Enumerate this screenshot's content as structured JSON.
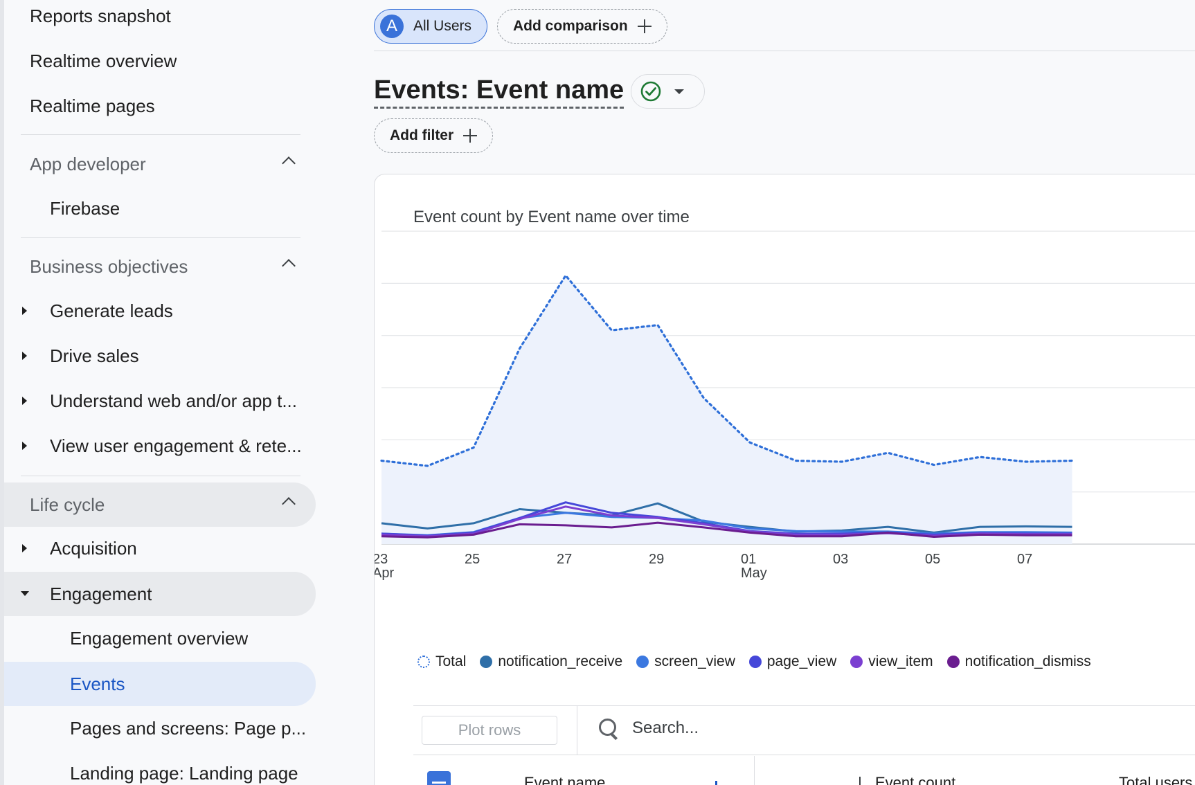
{
  "sidebar": {
    "items_top": [
      {
        "label": "Reports snapshot"
      },
      {
        "label": "Realtime overview"
      },
      {
        "label": "Realtime pages"
      }
    ],
    "app_developer": {
      "label": "App developer",
      "items": [
        {
          "label": "Firebase"
        }
      ]
    },
    "business_objectives": {
      "label": "Business objectives",
      "items": [
        {
          "label": "Generate leads"
        },
        {
          "label": "Drive sales"
        },
        {
          "label": "Understand web and/or app t..."
        },
        {
          "label": "View user engagement & rete..."
        }
      ]
    },
    "life_cycle": {
      "label": "Life cycle",
      "acquisition": {
        "label": "Acquisition"
      },
      "engagement": {
        "label": "Engagement",
        "items": [
          {
            "label": "Engagement overview"
          },
          {
            "label": "Events",
            "selected": true
          },
          {
            "label": "Pages and screens: Page p..."
          },
          {
            "label": "Landing page: Landing page"
          }
        ]
      }
    }
  },
  "header": {
    "segment_avatar": "A",
    "segment_label": "All Users",
    "add_comparison": "Add comparison",
    "title": "Events: Event name",
    "add_filter": "Add filter"
  },
  "chart_card": {
    "title": "Event count by Event name over time",
    "legend": [
      {
        "name": "Total",
        "color": "#2e6fd8"
      },
      {
        "name": "notification_receive",
        "color": "#2f6fa8"
      },
      {
        "name": "screen_view",
        "color": "#3b78e0"
      },
      {
        "name": "page_view",
        "color": "#4547d9"
      },
      {
        "name": "view_item",
        "color": "#7b3fd1"
      },
      {
        "name": "notification_dismiss",
        "color": "#6a1d8f"
      }
    ]
  },
  "chart_data": {
    "type": "line",
    "x_tick_labels": [
      "23",
      "25",
      "27",
      "29",
      "01",
      "03",
      "05",
      "07"
    ],
    "x_tick_sublabels": {
      "23": "Apr",
      "01": "May"
    },
    "x": [
      "Apr 23",
      "Apr 24",
      "Apr 25",
      "Apr 26",
      "Apr 27",
      "Apr 28",
      "Apr 29",
      "Apr 30",
      "May 01",
      "May 02",
      "May 03",
      "May 04",
      "May 05",
      "May 06",
      "May 07",
      "May 08"
    ],
    "gridlines": 6,
    "ylim": [
      0,
      6
    ],
    "series": [
      {
        "name": "Total",
        "style": "dotted-area",
        "color": "#2e6fd8",
        "values": [
          1.6,
          1.5,
          1.85,
          3.75,
          5.15,
          4.1,
          4.2,
          2.8,
          1.95,
          1.6,
          1.58,
          1.75,
          1.52,
          1.67,
          1.58,
          1.6
        ]
      },
      {
        "name": "notification_receive",
        "color": "#2f6fa8",
        "values": [
          0.4,
          0.3,
          0.4,
          0.67,
          0.6,
          0.55,
          0.78,
          0.43,
          0.33,
          0.24,
          0.26,
          0.33,
          0.22,
          0.33,
          0.34,
          0.33
        ]
      },
      {
        "name": "screen_view",
        "color": "#3b78e0",
        "values": [
          0.2,
          0.17,
          0.23,
          0.5,
          0.6,
          0.52,
          0.5,
          0.45,
          0.3,
          0.25,
          0.24,
          0.24,
          0.2,
          0.23,
          0.23,
          0.22
        ]
      },
      {
        "name": "page_view",
        "color": "#4547d9",
        "values": [
          0.2,
          0.16,
          0.22,
          0.5,
          0.8,
          0.6,
          0.52,
          0.4,
          0.25,
          0.2,
          0.2,
          0.22,
          0.18,
          0.21,
          0.2,
          0.2
        ]
      },
      {
        "name": "view_item",
        "color": "#7b3fd1",
        "values": [
          0.18,
          0.15,
          0.2,
          0.48,
          0.72,
          0.55,
          0.5,
          0.38,
          0.24,
          0.18,
          0.18,
          0.21,
          0.16,
          0.2,
          0.19,
          0.19
        ]
      },
      {
        "name": "notification_dismiss",
        "color": "#6a1d8f",
        "values": [
          0.15,
          0.13,
          0.18,
          0.38,
          0.36,
          0.32,
          0.41,
          0.32,
          0.22,
          0.15,
          0.15,
          0.22,
          0.14,
          0.18,
          0.17,
          0.17
        ]
      }
    ]
  },
  "table": {
    "plot_rows_label": "Plot rows",
    "search_placeholder": "Search...",
    "col_event_name": "Event name",
    "col_event_count": "Event count",
    "col_total_users": "Total users"
  }
}
